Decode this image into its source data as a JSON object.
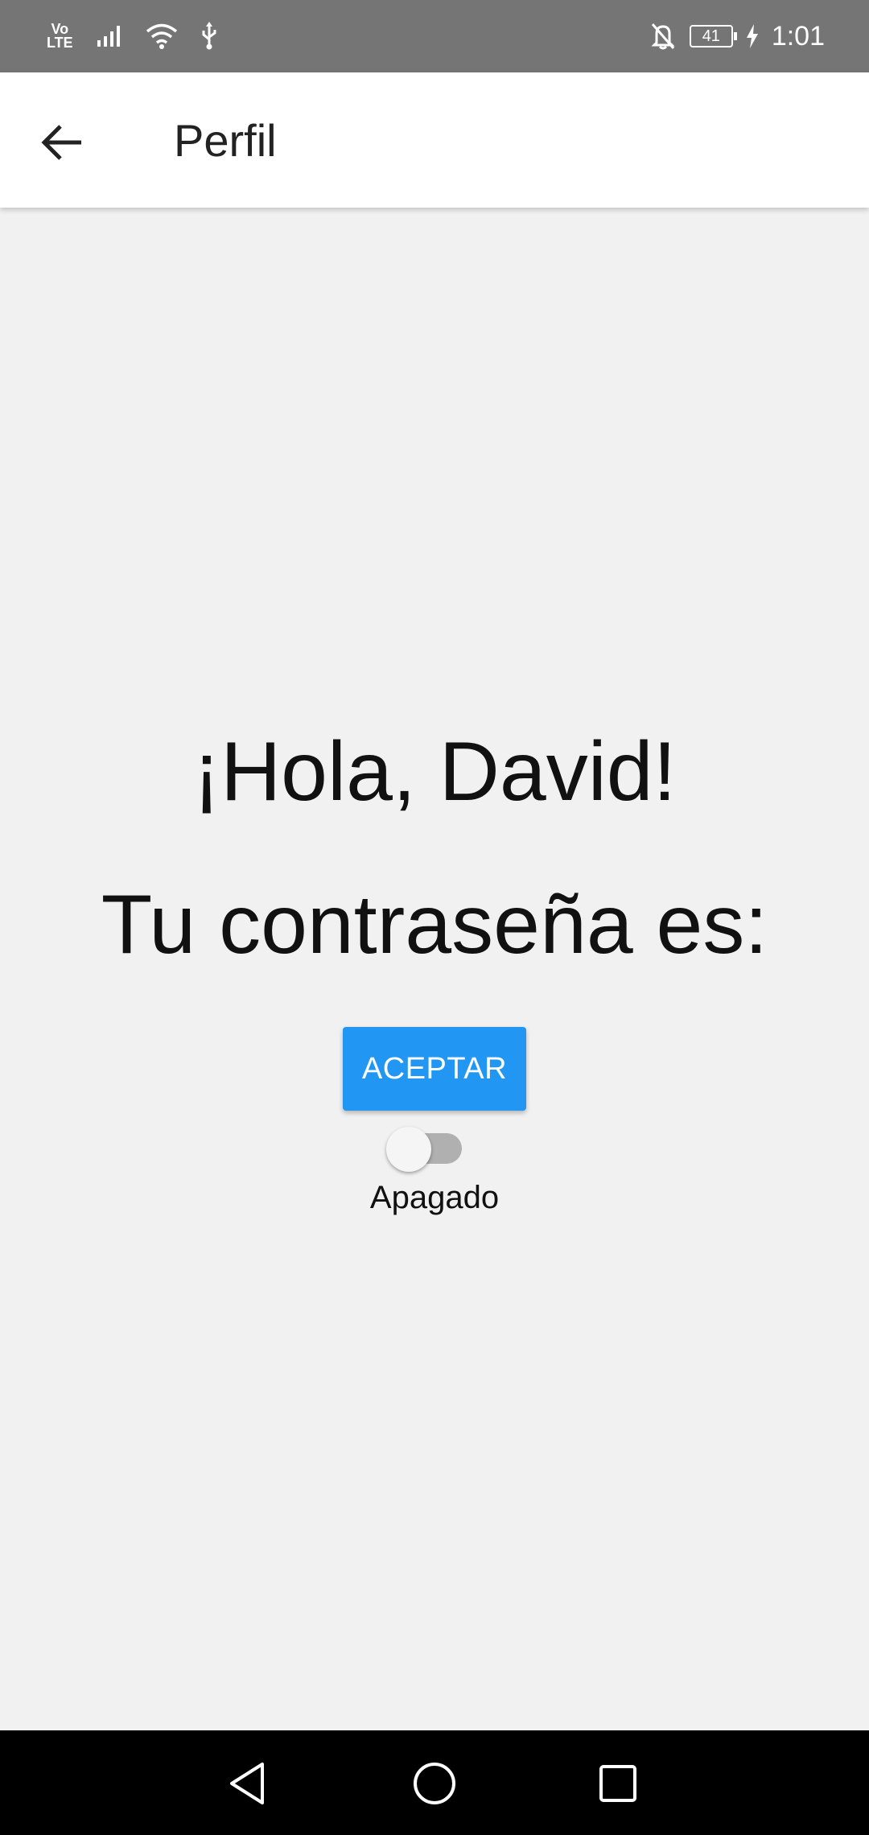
{
  "status_bar": {
    "network_label_top": "Vo",
    "network_label_bottom": "LTE",
    "battery_level": "41",
    "time": "1:01",
    "icons": [
      "volte-icon",
      "signal-icon",
      "wifi-icon",
      "usb-icon",
      "bell-off-icon",
      "battery-icon",
      "charging-icon"
    ]
  },
  "app_bar": {
    "title": "Perfil",
    "back_icon": "arrow-back-icon"
  },
  "main": {
    "greeting": "¡Hola, David!",
    "password_text": "Tu contraseña es:",
    "accept_button": "ACEPTAR",
    "switch_state": "off",
    "switch_label": "Apagado"
  },
  "nav_bar": {
    "icons": [
      "back-triangle-icon",
      "home-circle-icon",
      "recents-square-icon"
    ]
  },
  "colors": {
    "accent": "#2196f3",
    "status_bar": "#757575",
    "background": "#f1f1f1"
  }
}
